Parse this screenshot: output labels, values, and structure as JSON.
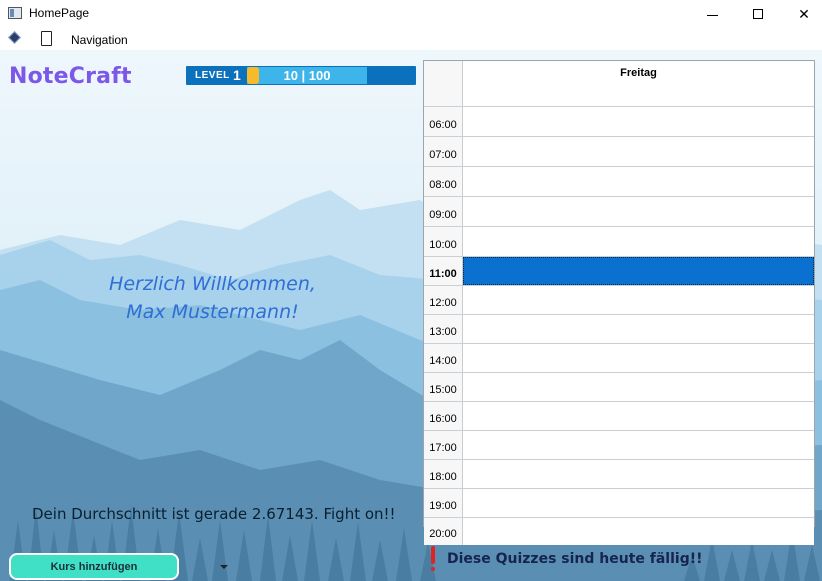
{
  "window": {
    "title": "HomePage",
    "controls": {
      "minimize": "minimize-icon",
      "maximize": "maximize-icon",
      "close": "✕"
    }
  },
  "menubar": {
    "icons": [
      "gem-icon",
      "device-icon"
    ],
    "navigation_label": "Navigation"
  },
  "app": {
    "logo": "NoteCraft",
    "level": {
      "label": "LEVEL",
      "value": "1",
      "xp_text": "10 | 100",
      "xp_fraction": 0.1
    },
    "welcome_line1": "Herzlich Willkommen,",
    "welcome_line2": "Max Mustermann!",
    "average_text": "Dein Durchschnitt ist gerade 2.67143. Fight on!!",
    "add_course_label": "Kurs hinzufügen"
  },
  "calendar": {
    "day": "Freitag",
    "selected_time": "11:00",
    "times": [
      "06:00",
      "07:00",
      "08:00",
      "09:00",
      "10:00",
      "11:00",
      "12:00",
      "13:00",
      "14:00",
      "15:00",
      "16:00",
      "17:00",
      "18:00",
      "19:00",
      "20:00"
    ]
  },
  "quiz": {
    "icon": "exclamation-icon",
    "text": "Diese Quizzes sind heute fällig!!"
  },
  "colors": {
    "logo": "#7b58e8",
    "level_bar": "#0c71bd",
    "xp_track": "#3db4ea",
    "xp_fill": "#f7ba2a",
    "welcome": "#2f6fd4",
    "selected_slot": "#0b71d1",
    "add_course_button": "#3fe0c5",
    "alert": "#e02323"
  }
}
